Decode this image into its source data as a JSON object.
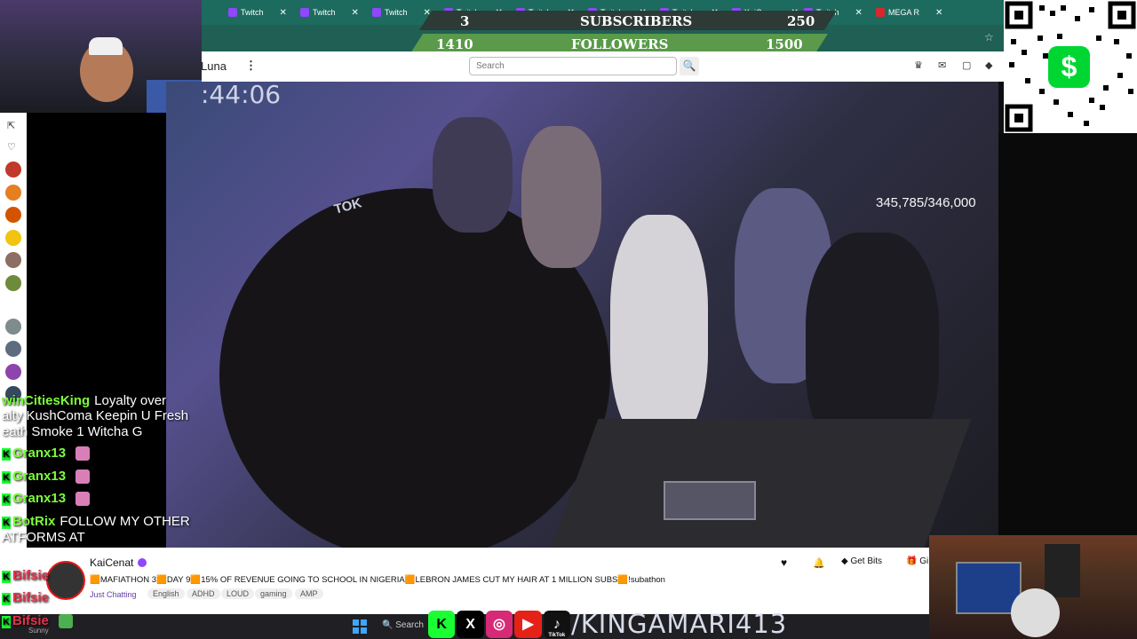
{
  "browser": {
    "tabs": [
      {
        "label": "Twitch"
      },
      {
        "label": "Twitch"
      },
      {
        "label": "Twitch"
      },
      {
        "label": "Twitch"
      },
      {
        "label": "Twitch"
      },
      {
        "label": "Twitch"
      },
      {
        "label": "Twitch"
      },
      {
        "label": "KaiCena"
      },
      {
        "label": "Twitch"
      },
      {
        "label": "MEGA R"
      }
    ],
    "close_glyph": "✕",
    "bookmark_icon": "☆"
  },
  "overlay": {
    "subs_current": "3",
    "subs_label": "SUBSCRIBERS",
    "subs_goal": "250",
    "followers_current": "1410",
    "followers_label": "FOLLOWERS",
    "followers_goal": "1500"
  },
  "twitch_nav": {
    "luna_label": "Luna",
    "more_glyph": "⋮",
    "search_placeholder": "Search",
    "search_icon": "🔍"
  },
  "stream": {
    "timer": ":44:06",
    "goal_counter": "345,785/346,000",
    "sign_text": "TOK"
  },
  "chat": {
    "lines": [
      {
        "user": "winCitiesKing",
        "text": "Loyalty over"
      },
      {
        "user": "",
        "text": "alty KushComa Keepin U Fresh"
      },
      {
        "user": "",
        "text": "eath Smoke 1 Witcha G"
      },
      {
        "user": "Granx13",
        "text": ""
      },
      {
        "user": "Granx13",
        "text": ""
      },
      {
        "user": "Granx13",
        "text": ""
      },
      {
        "user": "BotRix",
        "text": "FOLLOW MY OTHER"
      },
      {
        "user": "",
        "text": "ATFORMS AT"
      },
      {
        "user": "Bifsie",
        "text": ""
      },
      {
        "user": "Bifsie",
        "text": ""
      },
      {
        "user": "Bifsie",
        "text": ""
      }
    ],
    "sunny_label": "Sunny"
  },
  "channel": {
    "name": "KaiCenat",
    "title": "🟧MAFIATHON 3🟧DAY 9🟧15% OF REVENUE GOING TO SCHOOL IN NIGERIA🟧LEBRON JAMES CUT MY HAIR AT 1 MILLION SUBS🟧!subathon",
    "category": "Just Chatting",
    "tags": [
      "English",
      "ADHD",
      "LOUD",
      "gaming",
      "AMP"
    ],
    "get_bits": "Get Bits",
    "gift": "Gi"
  },
  "taskbar": {
    "search_label": "Search",
    "socials": [
      "K",
      "X",
      "◎",
      "▶",
      "♪"
    ],
    "tiktok_label": "TikTok",
    "handle": "/KINGAMARI413"
  },
  "cashapp": {
    "symbol": "$"
  },
  "colors": {
    "twitch_purple": "#9146ff",
    "kick_green": "#1aff34",
    "cashapp_green": "#00d632",
    "followers_green": "#5a9a4a"
  }
}
